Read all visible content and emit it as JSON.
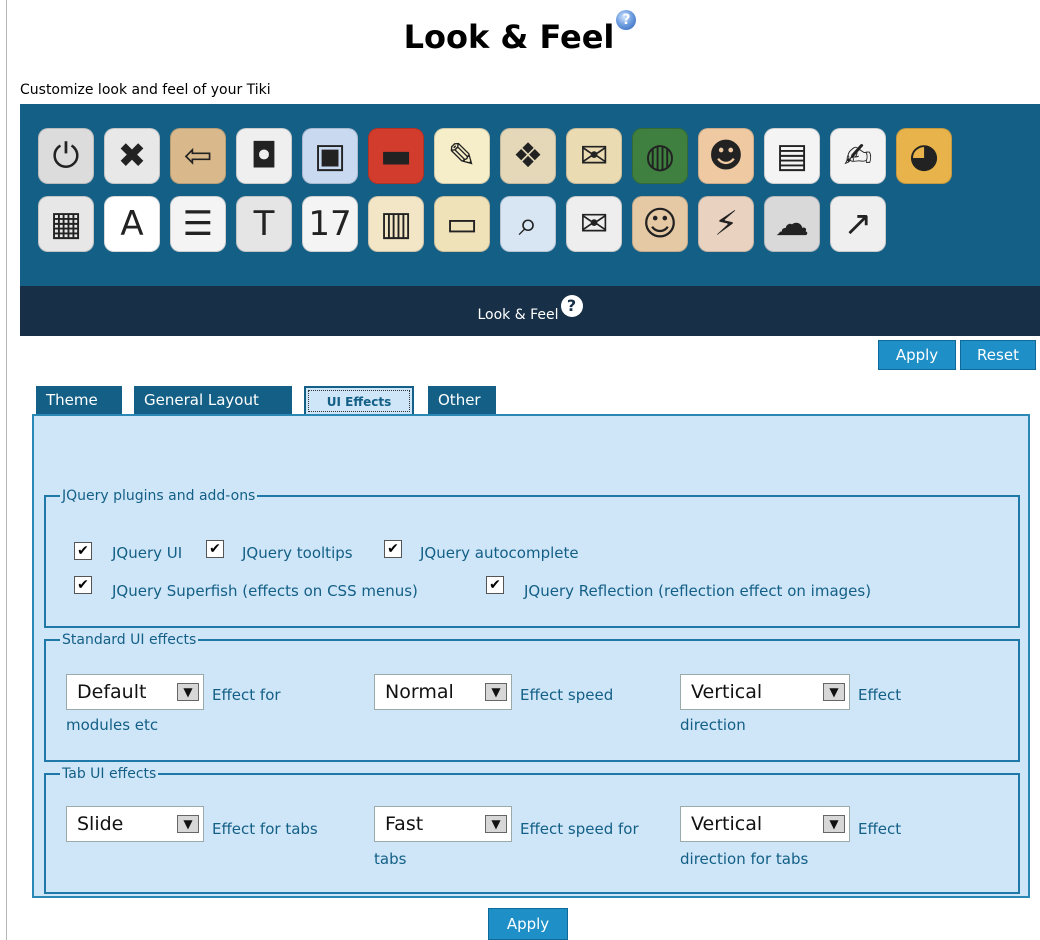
{
  "page": {
    "title": "Look & Feel",
    "subtitle": "Customize look and feel of your Tiki",
    "help_glyph": "?"
  },
  "toolbar": {
    "row1": [
      {
        "icon": "power-icon",
        "glyph": "⏻",
        "bg": "#dcdcdc"
      },
      {
        "icon": "tools-icon",
        "glyph": "✖",
        "bg": "#e8e8e8"
      },
      {
        "icon": "login-door-icon",
        "glyph": "⇦",
        "bg": "#d9b98b"
      },
      {
        "icon": "profile-silhouette-icon",
        "glyph": "◘",
        "bg": "#efefef"
      },
      {
        "icon": "look-feel-picture-icon",
        "glyph": "▣",
        "bg": "#c8d9f0"
      },
      {
        "icon": "german-flag-icon",
        "glyph": "▬",
        "bg": "#d23c2c"
      },
      {
        "icon": "notepad-pencil-icon",
        "glyph": "✎",
        "bg": "#f6eec8"
      },
      {
        "icon": "puzzle-pieces-icon",
        "glyph": "❖",
        "bg": "#e5d8b8"
      },
      {
        "icon": "mail-card-icon",
        "glyph": "✉",
        "bg": "#eadbb3"
      },
      {
        "icon": "globe-icon",
        "glyph": "◍",
        "bg": "#3f7f3f"
      },
      {
        "icon": "users-icon",
        "glyph": "☻",
        "bg": "#efc9a2"
      },
      {
        "icon": "wiki-document-icon",
        "glyph": "▤",
        "bg": "#f4f4f4"
      },
      {
        "icon": "edit-document-icon",
        "glyph": "✍",
        "bg": "#f3f3f3"
      },
      {
        "icon": "palette-icon",
        "glyph": "◕",
        "bg": "#e7b34a"
      }
    ],
    "row2": [
      {
        "icon": "card-file-icon",
        "glyph": "▦",
        "bg": "#e7e7e7"
      },
      {
        "icon": "font-a-icon",
        "glyph": "A",
        "bg": "#ffffff"
      },
      {
        "icon": "list-document-icon",
        "glyph": "☰",
        "bg": "#f4f4f4"
      },
      {
        "icon": "text-t-icon",
        "glyph": "T",
        "bg": "#e5e5e5"
      },
      {
        "icon": "calendar-icon",
        "glyph": "17",
        "bg": "#f4f4f4"
      },
      {
        "icon": "clipboard-diagram-icon",
        "glyph": "▥",
        "bg": "#f2e6c6"
      },
      {
        "icon": "id-card-icon",
        "glyph": "▭",
        "bg": "#efe1b8"
      },
      {
        "icon": "magnifier-icon",
        "glyph": "⌕",
        "bg": "#d8e6f4"
      },
      {
        "icon": "send-mail-icon",
        "glyph": "✉",
        "bg": "#eeeeee"
      },
      {
        "icon": "user-cabinet-icon",
        "glyph": "☺",
        "bg": "#e5c8a4"
      },
      {
        "icon": "cable-plug-icon",
        "glyph": "⚡",
        "bg": "#e9d3c0"
      },
      {
        "icon": "brain-icon",
        "glyph": "☁",
        "bg": "#d9d9d9"
      },
      {
        "icon": "network-arrow-icon",
        "glyph": "↗",
        "bg": "#efefef"
      }
    ]
  },
  "section": {
    "title": "Look & Feel",
    "help_glyph": "?"
  },
  "actions": {
    "apply_label": "Apply",
    "reset_label": "Reset",
    "apply_bottom_label": "Apply"
  },
  "tabs": [
    {
      "label": "Theme",
      "active": false
    },
    {
      "label": "General Layout",
      "active": false
    },
    {
      "label": "UI Effects",
      "active": true
    },
    {
      "label": "Other",
      "active": false
    }
  ],
  "jquery": {
    "legend": "JQuery plugins and add-ons",
    "checkboxes": [
      {
        "label": "JQuery UI",
        "checked": true
      },
      {
        "label": "JQuery tooltips",
        "checked": true
      },
      {
        "label": "JQuery autocomplete",
        "checked": true
      },
      {
        "label": "JQuery Superfish (effects on CSS menus)",
        "checked": true
      },
      {
        "label": "JQuery Reflection (reflection effect on images)",
        "checked": true
      }
    ],
    "check_glyph": "✔"
  },
  "standard": {
    "legend": "Standard UI effects",
    "effect": {
      "value": "Default",
      "label_line1": "Effect for",
      "label_line2": "modules etc"
    },
    "speed": {
      "value": "Normal",
      "label_line1": "Effect speed",
      "label_line2": ""
    },
    "direction": {
      "value": "Vertical",
      "label_line1": "Effect",
      "label_line2": "direction"
    }
  },
  "tab_ui": {
    "legend": "Tab UI effects",
    "effect": {
      "value": "Slide",
      "label_line1": "Effect for tabs",
      "label_line2": ""
    },
    "speed": {
      "value": "Fast",
      "label_line1": "Effect speed for",
      "label_line2": "tabs"
    },
    "direction": {
      "value": "Vertical",
      "label_line1": "Effect",
      "label_line2": "direction for tabs"
    }
  },
  "select_arrow_glyph": "▼"
}
